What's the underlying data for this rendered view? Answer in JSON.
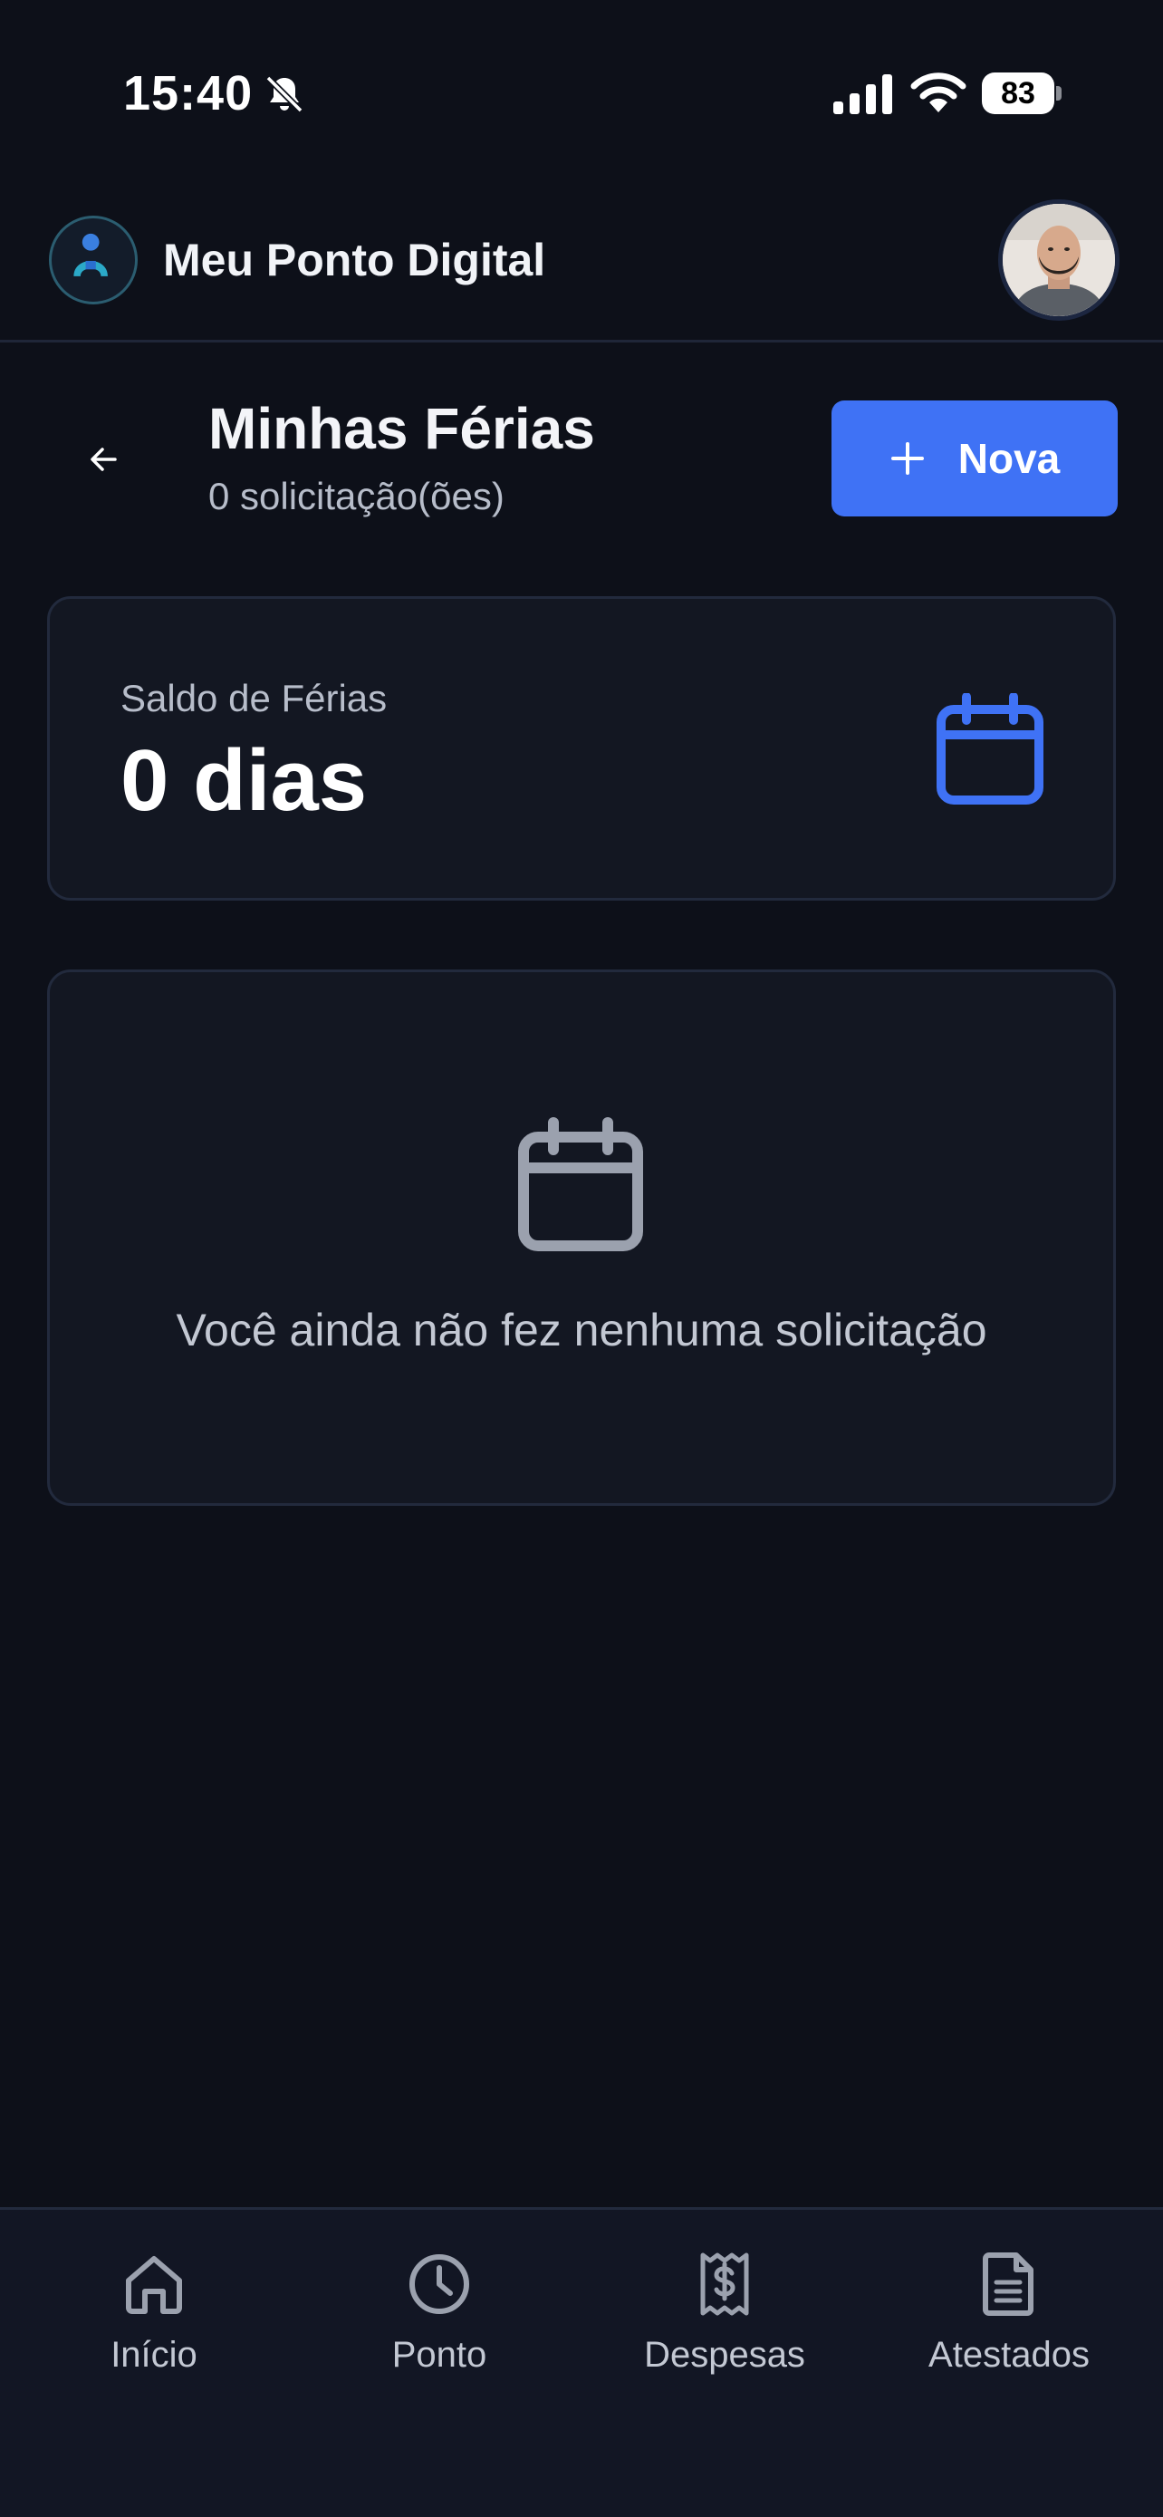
{
  "status_bar": {
    "time": "15:40",
    "battery": "83"
  },
  "app": {
    "name": "Meu Ponto Digital"
  },
  "page": {
    "title": "Minhas Férias",
    "subtitle": "0 solicitação(ões)",
    "new_button_label": "Nova"
  },
  "balance": {
    "label": "Saldo de Férias",
    "value": "0 dias"
  },
  "empty_state": {
    "message": "Você ainda não fez nenhuma solicitação"
  },
  "nav": {
    "items": [
      {
        "label": "Início",
        "icon": "home-icon"
      },
      {
        "label": "Ponto",
        "icon": "clock-icon"
      },
      {
        "label": "Despesas",
        "icon": "receipt-icon"
      },
      {
        "label": "Atestados",
        "icon": "document-icon"
      }
    ]
  },
  "colors": {
    "background": "#0d1019",
    "card": "#131722",
    "accent": "#3f72f5",
    "muted_text": "#b7bdca"
  }
}
